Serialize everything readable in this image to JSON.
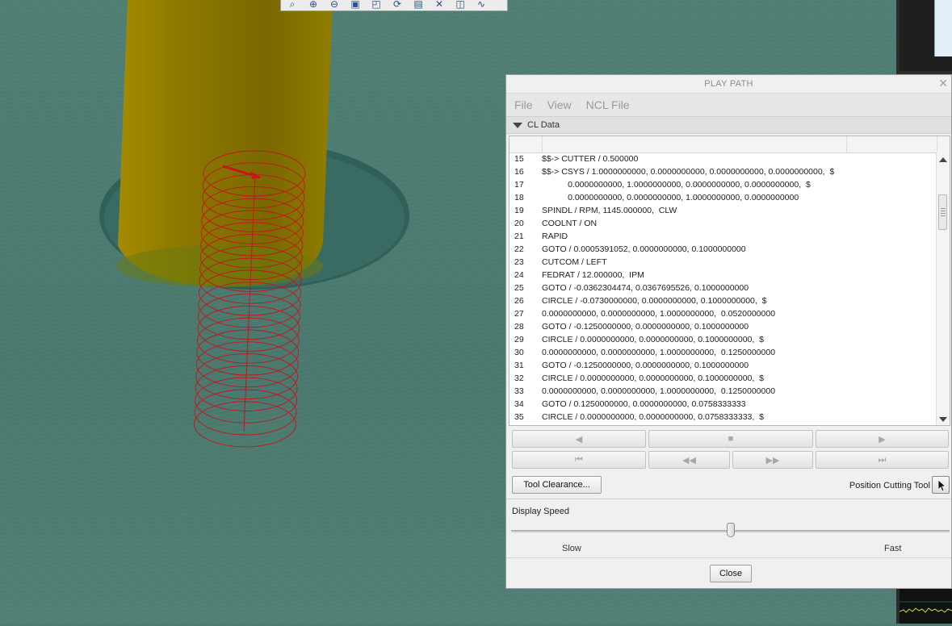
{
  "dialog": {
    "title": "PLAY PATH",
    "menu": [
      "File",
      "View",
      "NCL File"
    ],
    "section_label": "CL Data",
    "rows": [
      {
        "num": "15",
        "text": "$$-> CUTTER / 0.500000"
      },
      {
        "num": "16",
        "text": "$$-> CSYS / 1.0000000000, 0.0000000000, 0.0000000000, 0.0000000000,  $"
      },
      {
        "num": "17",
        "text": "           0.0000000000, 1.0000000000, 0.0000000000, 0.0000000000,  $"
      },
      {
        "num": "18",
        "text": "           0.0000000000, 0.0000000000, 1.0000000000, 0.0000000000"
      },
      {
        "num": "19",
        "text": "SPINDL / RPM, 1145.000000,  CLW"
      },
      {
        "num": "20",
        "text": "COOLNT / ON"
      },
      {
        "num": "21",
        "text": "RAPID"
      },
      {
        "num": "22",
        "text": "GOTO / 0.0005391052, 0.0000000000, 0.1000000000"
      },
      {
        "num": "23",
        "text": "CUTCOM / LEFT"
      },
      {
        "num": "24",
        "text": "FEDRAT / 12.000000,  IPM"
      },
      {
        "num": "25",
        "text": "GOTO / -0.0362304474, 0.0367695526, 0.1000000000"
      },
      {
        "num": "26",
        "text": "CIRCLE / -0.0730000000, 0.0000000000, 0.1000000000,  $"
      },
      {
        "num": "27",
        "text": "0.0000000000, 0.0000000000, 1.0000000000,  0.0520000000"
      },
      {
        "num": "28",
        "text": "GOTO / -0.1250000000, 0.0000000000, 0.1000000000"
      },
      {
        "num": "29",
        "text": "CIRCLE / 0.0000000000, 0.0000000000, 0.1000000000,  $"
      },
      {
        "num": "30",
        "text": "0.0000000000, 0.0000000000, 1.0000000000,  0.1250000000"
      },
      {
        "num": "31",
        "text": "GOTO / -0.1250000000, 0.0000000000, 0.1000000000"
      },
      {
        "num": "32",
        "text": "CIRCLE / 0.0000000000, 0.0000000000, 0.1000000000,  $"
      },
      {
        "num": "33",
        "text": "0.0000000000, 0.0000000000, 1.0000000000,  0.1250000000"
      },
      {
        "num": "34",
        "text": "GOTO / 0.1250000000, 0.0000000000, 0.0758333333"
      },
      {
        "num": "35",
        "text": "CIRCLE / 0.0000000000, 0.0000000000, 0.0758333333,  $"
      }
    ],
    "tool_clearance_label": "Tool Clearance...",
    "position_cutting_tool_label": "Position Cutting Tool",
    "display_speed_label": "Display Speed",
    "slow_label": "Slow",
    "fast_label": "Fast",
    "speed_level_fraction": 0.5,
    "close_label": "Close"
  },
  "toolbar_icons": [
    "zoom-window-icon",
    "zoom-in-icon",
    "zoom-out-icon",
    "fit-view-icon",
    "view-orient-icon",
    "rotate-view-icon",
    "snapshot-icon",
    "measure-icon",
    "cut-view-icon",
    "path-icon"
  ],
  "colors": {
    "viewport_bg": "#4e7b71",
    "tool_yellow": "#8c7a00",
    "toolpath_red": "#c4141c"
  }
}
